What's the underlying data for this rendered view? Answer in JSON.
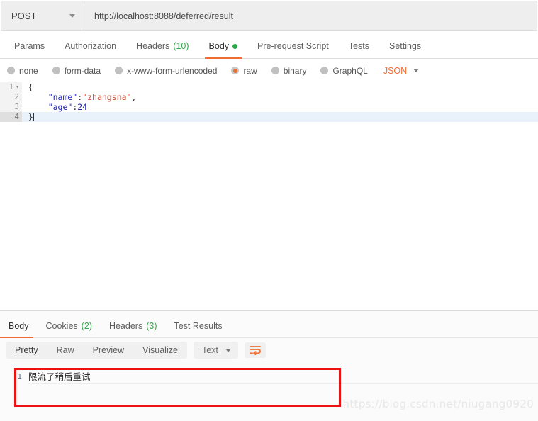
{
  "request": {
    "method": "POST",
    "url": "http://localhost:8088/deferred/result",
    "tabs": [
      {
        "label": "Params",
        "count": "",
        "active": false
      },
      {
        "label": "Authorization",
        "count": "",
        "active": false
      },
      {
        "label": "Headers",
        "count": "(10)",
        "active": false
      },
      {
        "label": "Body",
        "count": "",
        "active": true
      },
      {
        "label": "Pre-request Script",
        "count": "",
        "active": false
      },
      {
        "label": "Tests",
        "count": "",
        "active": false
      },
      {
        "label": "Settings",
        "count": "",
        "active": false
      }
    ],
    "body_types": [
      {
        "label": "none",
        "selected": false
      },
      {
        "label": "form-data",
        "selected": false
      },
      {
        "label": "x-www-form-urlencoded",
        "selected": false
      },
      {
        "label": "raw",
        "selected": true
      },
      {
        "label": "binary",
        "selected": false
      },
      {
        "label": "GraphQL",
        "selected": false
      }
    ],
    "format": "JSON",
    "editor_lines": [
      {
        "num": "1",
        "fold": "▾",
        "current": false,
        "tokens": [
          {
            "t": "{",
            "c": "tok-punc"
          }
        ]
      },
      {
        "num": "2",
        "fold": "",
        "current": false,
        "tokens": [
          {
            "t": "    \"name\"",
            "c": "tok-key"
          },
          {
            "t": ":",
            "c": "tok-punc"
          },
          {
            "t": "\"zhangsna\"",
            "c": "tok-str"
          },
          {
            "t": ",",
            "c": "tok-punc"
          }
        ]
      },
      {
        "num": "3",
        "fold": "",
        "current": false,
        "tokens": [
          {
            "t": "    \"age\"",
            "c": "tok-key"
          },
          {
            "t": ":",
            "c": "tok-punc"
          },
          {
            "t": "24",
            "c": "tok-num"
          }
        ]
      },
      {
        "num": "4",
        "fold": "",
        "current": true,
        "tokens": [
          {
            "t": "}",
            "c": "tok-punc"
          }
        ]
      }
    ]
  },
  "response": {
    "tabs": [
      {
        "label": "Body",
        "count": "",
        "active": true
      },
      {
        "label": "Cookies",
        "count": "(2)",
        "active": false
      },
      {
        "label": "Headers",
        "count": "(3)",
        "active": false
      },
      {
        "label": "Test Results",
        "count": "",
        "active": false
      }
    ],
    "format_tabs": [
      {
        "label": "Pretty",
        "active": true
      },
      {
        "label": "Raw",
        "active": false
      },
      {
        "label": "Preview",
        "active": false
      },
      {
        "label": "Visualize",
        "active": false
      }
    ],
    "content_type": "Text",
    "body_lines": [
      {
        "num": "1",
        "text": "限流了稍后重试"
      }
    ]
  },
  "watermark": "https://blog.csdn.net/niugang0920",
  "colors": {
    "accent": "#ef6c35",
    "green": "#27a745",
    "annotation": "#ee1111"
  }
}
